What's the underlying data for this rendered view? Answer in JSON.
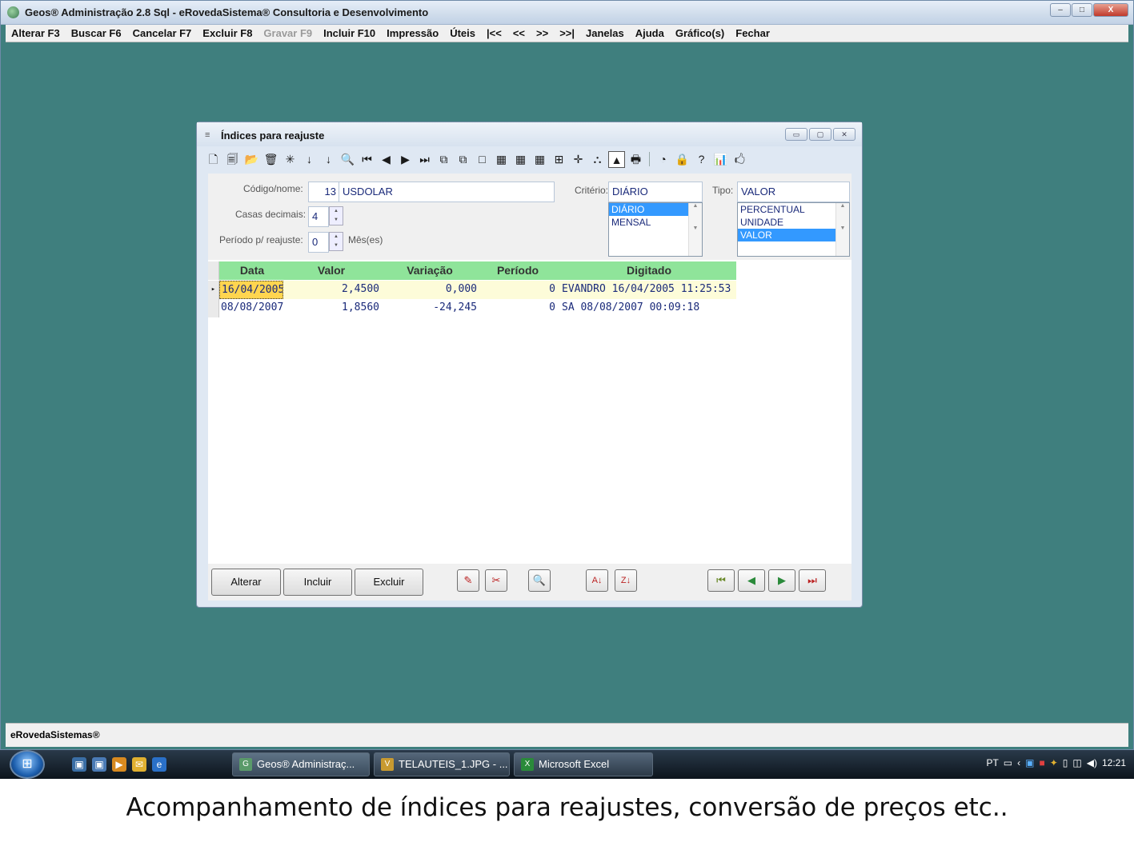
{
  "window": {
    "title": "Geos® Administração 2.8 Sql - eRovedaSistema® Consultoria e Desenvolvimento",
    "controls": {
      "minimize": "–",
      "maximize": "□",
      "close": "X"
    }
  },
  "menu": {
    "items": [
      {
        "label": "Alterar F3",
        "enabled": true
      },
      {
        "label": "Buscar F6",
        "enabled": true
      },
      {
        "label": "Cancelar F7",
        "enabled": true
      },
      {
        "label": "Excluir F8",
        "enabled": true
      },
      {
        "label": "Gravar F9",
        "enabled": false
      },
      {
        "label": "Incluir F10",
        "enabled": true
      },
      {
        "label": "Impressão",
        "enabled": true
      },
      {
        "label": "Úteis",
        "enabled": true
      },
      {
        "label": "|<<",
        "enabled": true
      },
      {
        "label": "<<",
        "enabled": true
      },
      {
        "label": ">>",
        "enabled": true
      },
      {
        "label": ">>|",
        "enabled": true
      },
      {
        "label": "Janelas",
        "enabled": true
      },
      {
        "label": "Ajuda",
        "enabled": true
      },
      {
        "label": "Gráfico(s)",
        "enabled": true
      },
      {
        "label": "Fechar",
        "enabled": true
      }
    ]
  },
  "child": {
    "title": "Índices para reajuste",
    "icon": "≡",
    "controls": {
      "minimize": "▭",
      "maximize": "▢",
      "close": "✕"
    },
    "toolbar_icons": [
      "🗋",
      "🗐",
      "📂",
      "🗑",
      "✳",
      "↓",
      "↓",
      "🔍",
      "⏮",
      "◀",
      "▶",
      "⏭",
      "⧉",
      "⧉",
      "□",
      "▦",
      "▦",
      "▦",
      "⊞",
      "✛",
      "⛬",
      "▲",
      "🖶",
      "◔",
      "🔒",
      "?",
      "📊",
      "🖒"
    ],
    "form": {
      "codigo_label": "Código/nome:",
      "codigo_value": "13",
      "nome_value": "USDOLAR",
      "casas_label": "Casas decimais:",
      "casas_value": "4",
      "periodo_label": "Período p/ reajuste:",
      "periodo_value": "0",
      "periodo_unit": "Mês(es)",
      "criterio_label": "Critério:",
      "criterio_value": "DIÁRIO",
      "criterio_options": [
        "DIÁRIO",
        "MENSAL"
      ],
      "criterio_selected": "DIÁRIO",
      "tipo_label": "Tipo:",
      "tipo_value": "VALOR",
      "tipo_options": [
        "PERCENTUAL",
        "UNIDADE",
        "VALOR"
      ],
      "tipo_selected": "VALOR"
    },
    "grid": {
      "headers": [
        "Data",
        "Valor",
        "Variação",
        "Período",
        "Digitado"
      ],
      "rows": [
        {
          "data": "16/04/2005",
          "valor": "2,4500",
          "variacao": "0,000",
          "periodo": "0",
          "digitado": "EVANDRO 16/04/2005 11:25:53"
        },
        {
          "data": "08/08/2007",
          "valor": "1,8560",
          "variacao": "-24,245",
          "periodo": "0",
          "digitado": "SA 08/08/2007 00:09:18"
        }
      ],
      "current_row_marker": "▸"
    },
    "buttons": {
      "alterar": "Alterar",
      "incluir": "Incluir",
      "excluir": "Excluir"
    },
    "icon_buttons": {
      "wand": "✎",
      "cut": "✂",
      "search": "🔍",
      "sort_az": "A↓",
      "sort_za": "Z↓",
      "first": "⏮",
      "prev": "◀",
      "next": "▶",
      "last": "⏭"
    }
  },
  "status": {
    "text": "eRovedaSistemas®"
  },
  "taskbar": {
    "start_glyph": "⊞",
    "quicklaunch": [
      "▣",
      "▣",
      "▶",
      "✉",
      "e"
    ],
    "tasks": [
      {
        "label": "Geos® Administraç...",
        "icon": "G",
        "active": true
      },
      {
        "label": "TELAUTEIS_1.JPG - ...",
        "icon": "V",
        "active": false
      },
      {
        "label": "Microsoft Excel",
        "icon": "X",
        "active": false
      }
    ],
    "tray": {
      "lang": "PT",
      "clock": "12:21"
    }
  },
  "caption": "Acompanhamento de índices para reajustes, conversão de preços etc.."
}
